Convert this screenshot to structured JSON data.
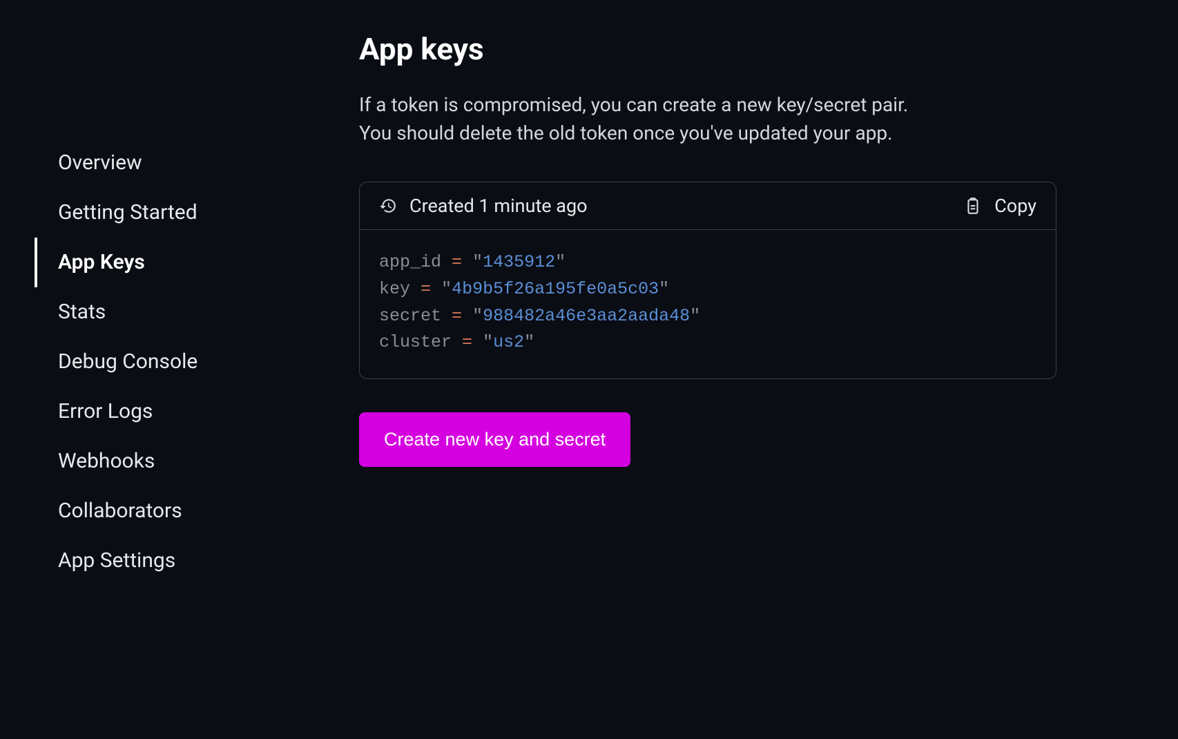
{
  "sidebar": {
    "items": [
      {
        "label": "Overview"
      },
      {
        "label": "Getting Started"
      },
      {
        "label": "App Keys"
      },
      {
        "label": "Stats"
      },
      {
        "label": "Debug Console"
      },
      {
        "label": "Error Logs"
      },
      {
        "label": "Webhooks"
      },
      {
        "label": "Collaborators"
      },
      {
        "label": "App Settings"
      }
    ],
    "active_index": 2
  },
  "main": {
    "title": "App keys",
    "description_line1": "If a token is compromised, you can create a new key/secret pair.",
    "description_line2": "You should delete the old token once you've updated your app.",
    "card": {
      "created_label": "Created 1 minute ago",
      "copy_label": "Copy",
      "fields": {
        "app_id": {
          "key": "app_id",
          "value": "1435912"
        },
        "key": {
          "key": "key",
          "value": "4b9b5f26a195fe0a5c03"
        },
        "secret": {
          "key": "secret",
          "value": "988482a46e3aa2aada48"
        },
        "cluster": {
          "key": "cluster",
          "value": "us2"
        }
      }
    },
    "create_button_label": "Create new key and secret"
  },
  "colors": {
    "bg": "#0b0d14",
    "border": "#3a3d52",
    "accent_button": "#d500e0",
    "code_key": "#8a8c96",
    "code_equals": "#d97757",
    "code_value": "#5a8fd6"
  }
}
